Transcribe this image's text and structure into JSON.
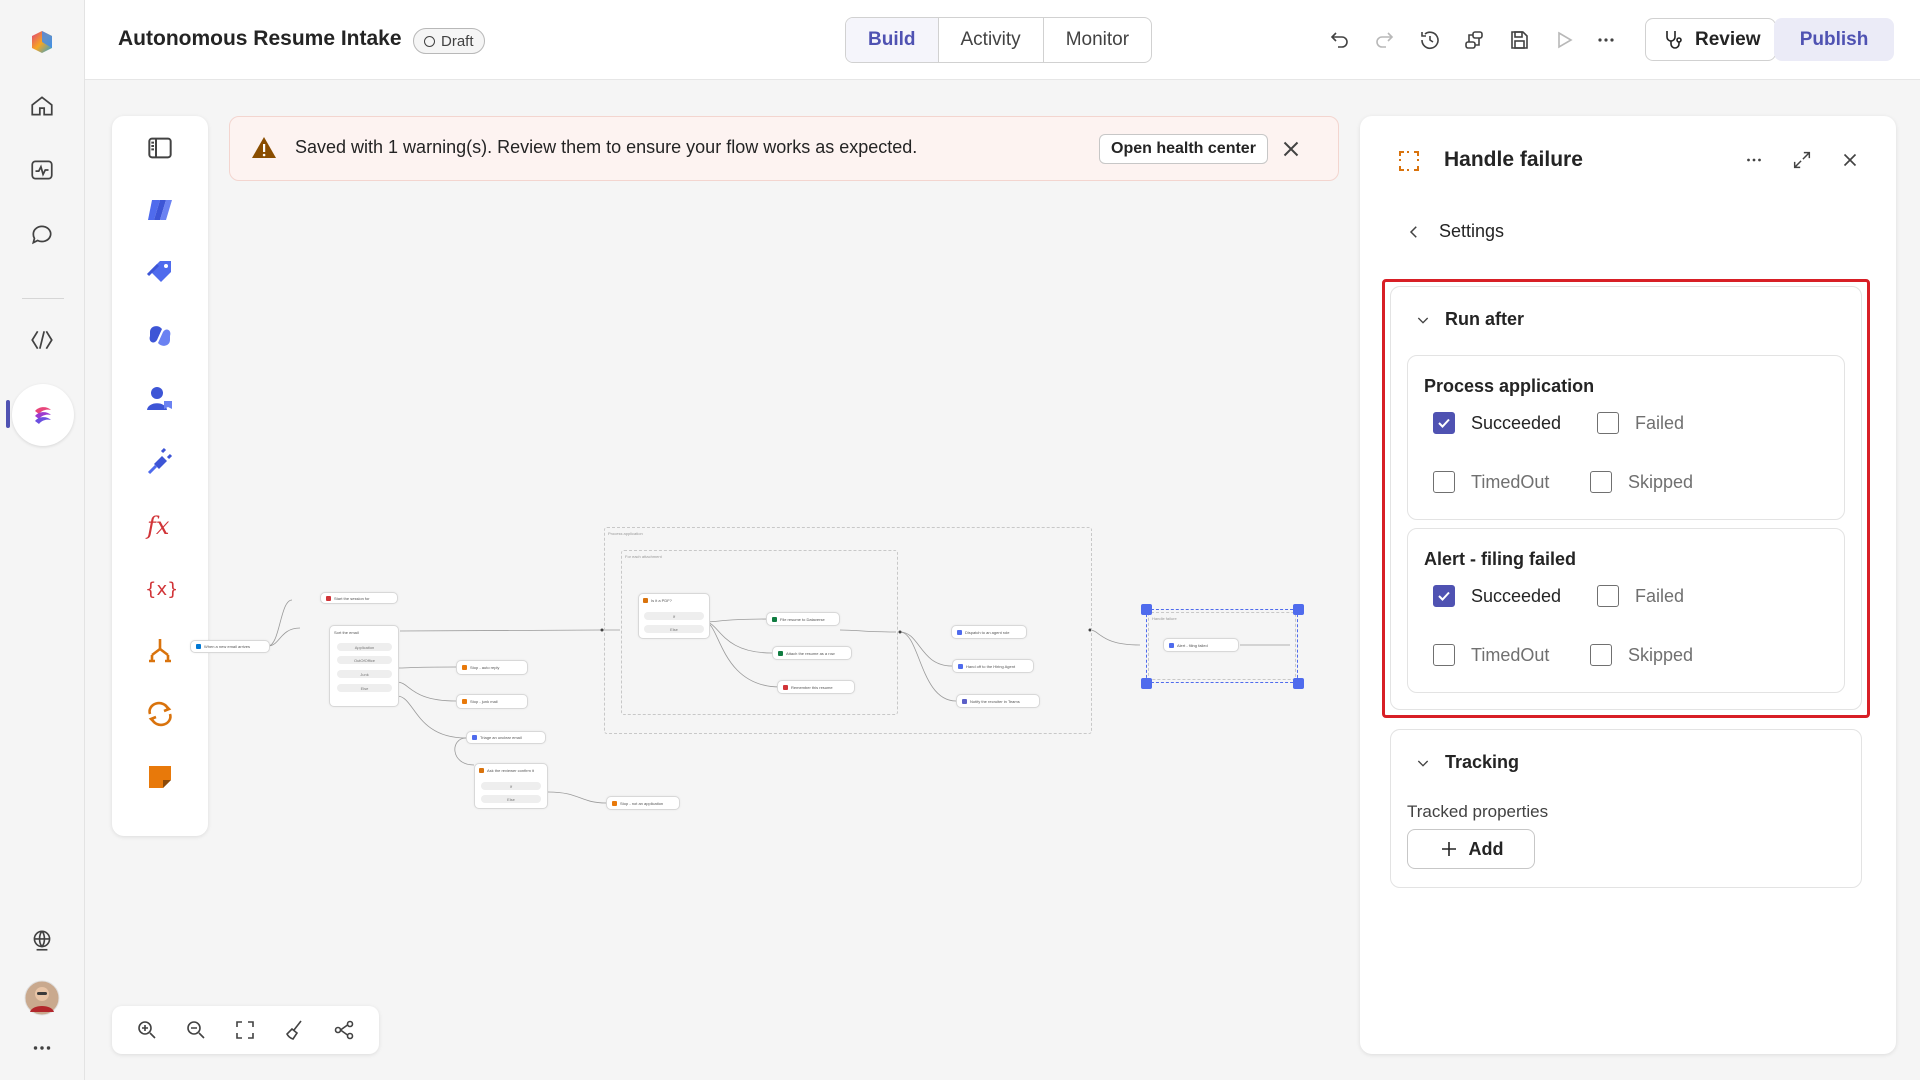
{
  "header": {
    "title": "Autonomous Resume Intake",
    "status": "Draft",
    "tabs": [
      {
        "label": "Build",
        "active": true
      },
      {
        "label": "Activity",
        "active": false
      },
      {
        "label": "Monitor",
        "active": false
      }
    ],
    "review_label": "Review",
    "publish_label": "Publish"
  },
  "banner": {
    "message": "Saved with 1 warning(s). Review them to ensure your flow works as expected.",
    "action_label": "Open health center"
  },
  "panel": {
    "title": "Handle failure",
    "back_label": "Settings",
    "run_after": {
      "heading": "Run after",
      "groups": [
        {
          "title": "Process application",
          "options": [
            {
              "label": "Succeeded",
              "checked": true
            },
            {
              "label": "Failed",
              "checked": false
            },
            {
              "label": "TimedOut",
              "checked": false
            },
            {
              "label": "Skipped",
              "checked": false
            }
          ]
        },
        {
          "title": "Alert - filing failed",
          "options": [
            {
              "label": "Succeeded",
              "checked": true
            },
            {
              "label": "Failed",
              "checked": false
            },
            {
              "label": "TimedOut",
              "checked": false
            },
            {
              "label": "Skipped",
              "checked": false
            }
          ]
        }
      ]
    },
    "tracking": {
      "heading": "Tracking",
      "label": "Tracked properties",
      "add_label": "Add"
    }
  },
  "canvas": {
    "trigger": "When a new email arrives",
    "nodes": {
      "start_session": "Start the session for",
      "sort_email": "Sort the email",
      "branch_application": "Application",
      "branch_outofoffice": "OutOfOffice",
      "branch_junk": "Junk",
      "branch_else": "Else",
      "stop_auto_reply": "Stop - auto reply",
      "stop_junk_mail": "Stop - junk mail",
      "triage_unclear": "Triage an unclear email",
      "ask_reviewer": "Ask the reviewer confirm it",
      "branch_yes": "If",
      "branch_no": "Else",
      "stop_not_app": "Stop - not an application",
      "process_application": "Process application",
      "for_each": "For each attachment",
      "is_pdf": "Is it a PDF?",
      "pdf_yes": "If",
      "pdf_else": "Else",
      "file_dataverse": "File resume to Dataverse",
      "attach_row": "Attach the resume as a row",
      "remember_resume": "Remember this resume",
      "dispatch_agent": "Dispatch to an agent role",
      "hand_off": "Hand off to the Hiring Agent",
      "notify_teams": "Notify the recruiter in Teams",
      "handle_failure": "Handle failure",
      "alert_filing": "Alert - filing failed"
    }
  },
  "colors": {
    "accent": "#4f52b2",
    "highlight": "#d81f26",
    "warning_bg": "#fdf3f1"
  }
}
